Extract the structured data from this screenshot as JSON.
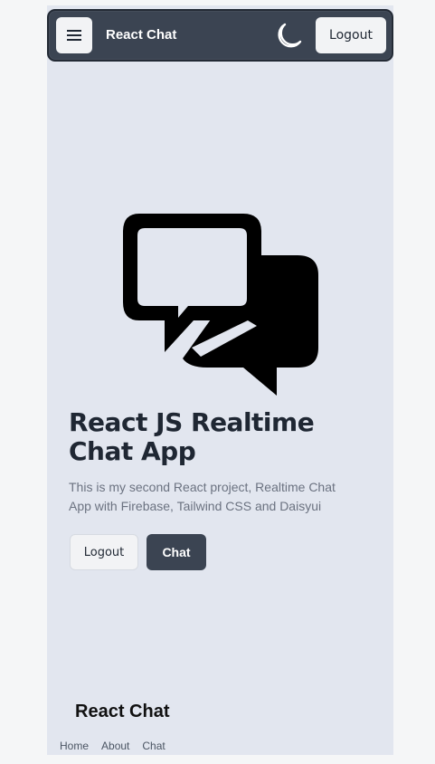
{
  "navbar": {
    "menu_icon": "hamburger-icon",
    "title": "React Chat",
    "theme_icon": "moon-icon",
    "logout_label": "Logout"
  },
  "hero": {
    "icon": "chat-bubbles-icon",
    "title": "React JS Realtime Chat App",
    "description": "This is my second React project, Realtime Chat App with Firebase, Tailwind CSS and Daisyui",
    "logout_label": "Logout",
    "chat_label": "Chat"
  },
  "footer": {
    "title": "React Chat",
    "links": [
      "Home",
      "About",
      "Chat"
    ]
  },
  "colors": {
    "navbar_bg": "#3b4452",
    "page_bg": "#e2e6ef",
    "button_light": "#f2f3f5"
  }
}
